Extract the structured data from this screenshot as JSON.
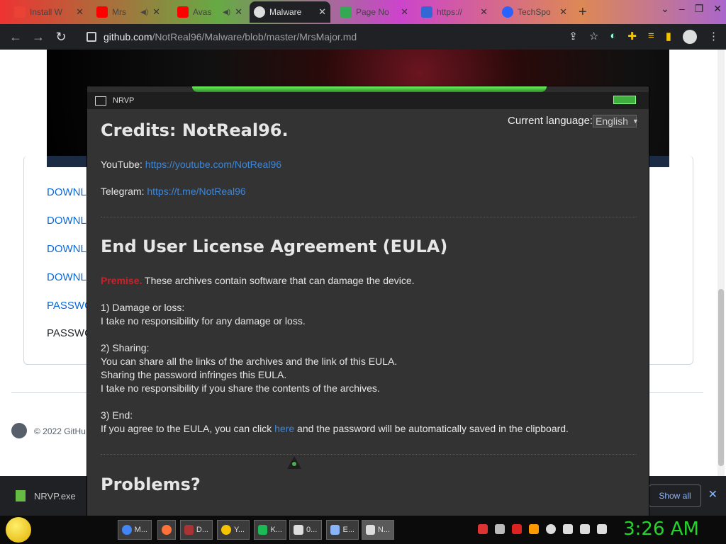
{
  "browser": {
    "tabs": [
      {
        "title": "Install W",
        "color": "#ea4335"
      },
      {
        "title": "Mrs",
        "color": "#ff0000"
      },
      {
        "title": "Avas",
        "color": "#ff0000"
      },
      {
        "title": "Malware",
        "color": "#24292f"
      },
      {
        "title": "Page No",
        "color": "#34a853"
      },
      {
        "title": "https://",
        "color": "#3367d6"
      },
      {
        "title": "TechSpo",
        "color": "#2962ff"
      }
    ],
    "url_host": "github.com",
    "url_path": "/NotReal96/Malware/blob/master/MrsMajor.md"
  },
  "page": {
    "downloads": [
      "DOWNL",
      "DOWNL",
      "DOWNL",
      "DOWNL"
    ],
    "password_link": "PASSWO",
    "password_text": "PASSWO",
    "copyright": "© 2022 GitHu"
  },
  "shelf": {
    "filename": "NRVP.exe",
    "show_all": "Show all",
    "close": "✕"
  },
  "nrvp": {
    "title": "NRVP",
    "language_label": "Current language:",
    "language_value": "English",
    "credits_heading": "Credits: NotReal96.",
    "youtube_label": "YouTube: ",
    "youtube_link": "https://youtube.com/NotReal96",
    "telegram_label": "Telegram: ",
    "telegram_link": "https://t.me/NotReal96",
    "eula_heading": "End User License Agreement (EULA)",
    "premise_label": "Premise.",
    "premise_text": " These archives contain software that can damage the device.",
    "s1_title": "1) Damage or loss:",
    "s1_l1": "I take no responsibility for any damage or loss.",
    "s2_title": "2) Sharing:",
    "s2_l1": "You can share all the links of the archives and the link of this EULA.",
    "s2_l2": "Sharing the password infringes this EULA.",
    "s2_l3": "I take no responsibility if you share the contents of the archives.",
    "s3_title": "3) End:",
    "s3_pre": "If you agree to the EULA, you can click ",
    "s3_link": "here",
    "s3_post": " and the password will be automatically saved in the clipboard.",
    "problems_heading": "Problems?"
  },
  "taskbar": {
    "items": [
      {
        "label": "M...",
        "color": "#4285f4"
      },
      {
        "label": "",
        "color": "#ff7139"
      },
      {
        "label": "D...",
        "color": "#a33"
      },
      {
        "label": "Y...",
        "color": "#f5c400"
      },
      {
        "label": "K...",
        "color": "#1db954"
      },
      {
        "label": "0...",
        "color": "#ddd"
      },
      {
        "label": "E...",
        "color": "#8ab4f8"
      },
      {
        "label": "N...",
        "color": "#ddd"
      }
    ],
    "clock": "3:26 AM"
  }
}
